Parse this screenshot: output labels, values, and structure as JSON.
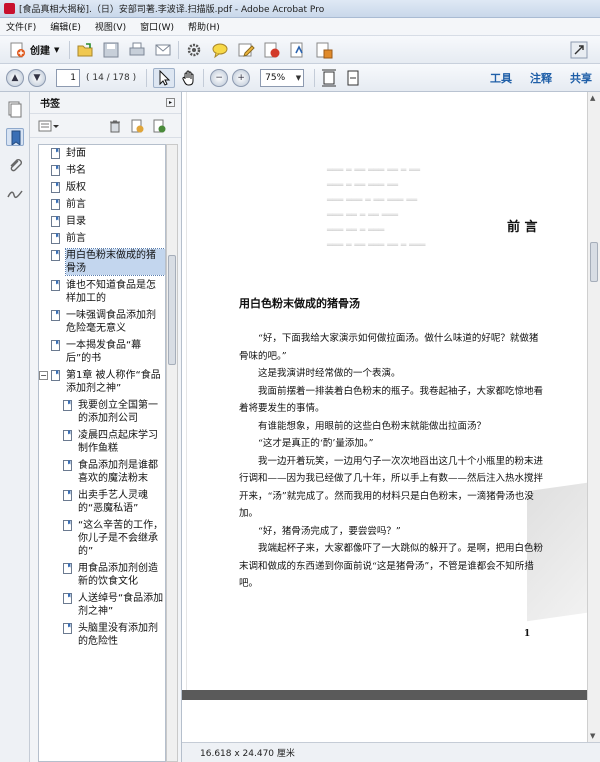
{
  "window": {
    "title": "[食品真相大揭秘].（日）安部司著.李波译.扫描版.pdf - Adobe Acrobat Pro"
  },
  "menu": [
    "文件(F)",
    "编辑(E)",
    "视图(V)",
    "窗口(W)",
    "帮助(H)"
  ],
  "toolbar": {
    "create_label": "创建",
    "icons": [
      "open-icon",
      "save-icon",
      "print-icon",
      "email-icon",
      "settings-icon",
      "comment-icon",
      "edit-icon",
      "secure-icon",
      "sign-icon",
      "share-icon"
    ]
  },
  "nav": {
    "page_value": "1",
    "page_count": "( 14 / 178 )",
    "zoom_value": "75%",
    "right_links": [
      "工具",
      "注释",
      "共享"
    ]
  },
  "bookmarks": {
    "header": "书签",
    "items": [
      {
        "label": "封面",
        "level": 0
      },
      {
        "label": "书名",
        "level": 0
      },
      {
        "label": "版权",
        "level": 0
      },
      {
        "label": "前言",
        "level": 0
      },
      {
        "label": "目录",
        "level": 0
      },
      {
        "label": "前言",
        "level": 0
      },
      {
        "label": "用白色粉末做成的猪骨汤",
        "level": 0,
        "selected": true
      },
      {
        "label": "谁也不知道食品是怎样加工的",
        "level": 0
      },
      {
        "label": "一味强调食品添加剂危险毫无意义",
        "level": 0
      },
      {
        "label": "一本揭发食品“幕后”的书",
        "level": 0
      },
      {
        "label": "第1章 被人称作“食品添加剂之神”",
        "level": 0,
        "expander": "⊟"
      },
      {
        "label": "我要创立全国第一的添加剂公司",
        "level": 1
      },
      {
        "label": "凌晨四点起床学习制作鱼糕",
        "level": 1
      },
      {
        "label": "食品添加剂是谁都喜欢的魔法粉末",
        "level": 1
      },
      {
        "label": "出卖手艺人灵魂的“恶魔私语”",
        "level": 1
      },
      {
        "label": "“这么辛苦的工作，你儿子是不会继承的”",
        "level": 1
      },
      {
        "label": "用食品添加剂创造新的饮食文化",
        "level": 1
      },
      {
        "label": "人送绰号“食品添加剂之神”",
        "level": 1
      },
      {
        "label": "头脑里没有添加剂的危险性",
        "level": 1
      }
    ]
  },
  "document": {
    "chapter_title": "前 言",
    "section_title": "用白色粉末做成的猪骨汤",
    "paragraphs": [
      "“好，下面我给大家演示如何做拉面汤。做什么味道的好呢？就做猪骨味的吧。”",
      "这是我演讲时经常做的一个表演。",
      "我面前摆着一排装着白色粉末的瓶子。我卷起袖子，大家都吃惊地看着将要发生的事情。",
      "有谁能想象，用眼前的这些白色粉末就能做出拉面汤？",
      "“这才是真正的‘酌’量添加。”",
      "我一边开着玩笑，一边用勺子一次次地舀出这几十个小瓶里的粉末进行调和——因为我已经做了几十年，所以手上有数——然后注入热水搅拌开来，“汤”就完成了。然而我用的材料只是白色粉末，一滴猪骨汤也没加。",
      "“好，猪骨汤完成了，要尝尝吗？”",
      "我端起杯子来，大家都像吓了一大跳似的躲开了。是啊，把用白色粉末调和做成的东西递到你面前说“这是猪骨汤”，不管是谁都会不知所措吧。"
    ],
    "page_number": "1"
  },
  "status": {
    "page_size": "16.618 x 24.470 厘米"
  },
  "colors": {
    "accent": "#1f5fa8",
    "selection": "#c3d6ee"
  }
}
